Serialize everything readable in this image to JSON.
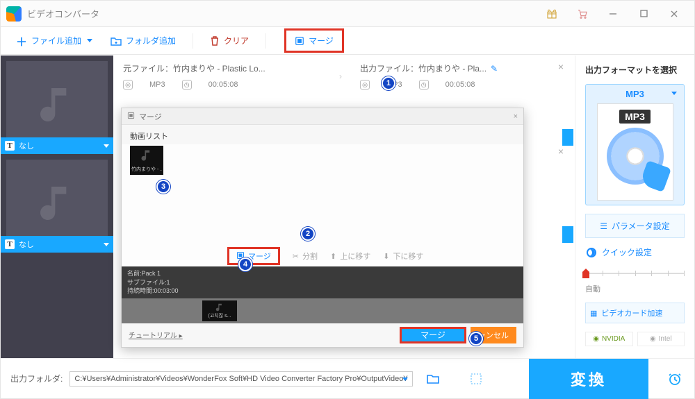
{
  "app": {
    "title": "ビデオコンバータ"
  },
  "toolbar": {
    "add_file": "ファイル追加",
    "add_folder": "フォルダ追加",
    "clear": "クリア",
    "merge": "マージ"
  },
  "thumbs": [
    {
      "caption": "なし"
    },
    {
      "caption": "なし"
    }
  ],
  "source_file": {
    "label_prefix": "元ファイル：",
    "name": "竹内まりや - Plastic Lo...",
    "format": "MP3",
    "duration": "00:05:08"
  },
  "output_file": {
    "label_prefix": "出力ファイル：",
    "name": "竹内まりや - Pla...",
    "format": "MP3",
    "duration": "00:05:08"
  },
  "right": {
    "title": "出力フォーマットを選択",
    "format_label": "MP3",
    "format_badge": "MP3",
    "param_btn": "パラメータ設定",
    "quick": "クイック設定",
    "auto": "自動",
    "gpu": "ビデオカード加速",
    "vendor_nvidia": "NVIDIA",
    "vendor_intel": "Intel"
  },
  "merge_dialog": {
    "title": "マージ",
    "subtitle": "動画リスト",
    "thumb_label": "竹内まりや - ...",
    "btn_merge": "マージ",
    "btn_split": "分割",
    "btn_up": "上に移す",
    "btn_down": "下に移す",
    "pack_name_label": "名前:",
    "pack_name": "Pack 1",
    "pack_sub_label": "サブファイル:",
    "pack_sub": "1",
    "pack_dur_label": "持続時間:",
    "pack_dur": "00:03:00",
    "clip_label": "(고치잖 s...",
    "tutorial": "チュートリアル",
    "footer_merge": "マージ",
    "footer_cancel": "ャンセル"
  },
  "bottom": {
    "label": "出力フォルダ:",
    "path": "C:¥Users¥Administrator¥Videos¥WonderFox Soft¥HD Video Converter Factory Pro¥OutputVideo¥",
    "convert": "変換"
  },
  "badges": {
    "b1": "1",
    "b2": "2",
    "b3": "3",
    "b4": "4",
    "b5": "5"
  }
}
